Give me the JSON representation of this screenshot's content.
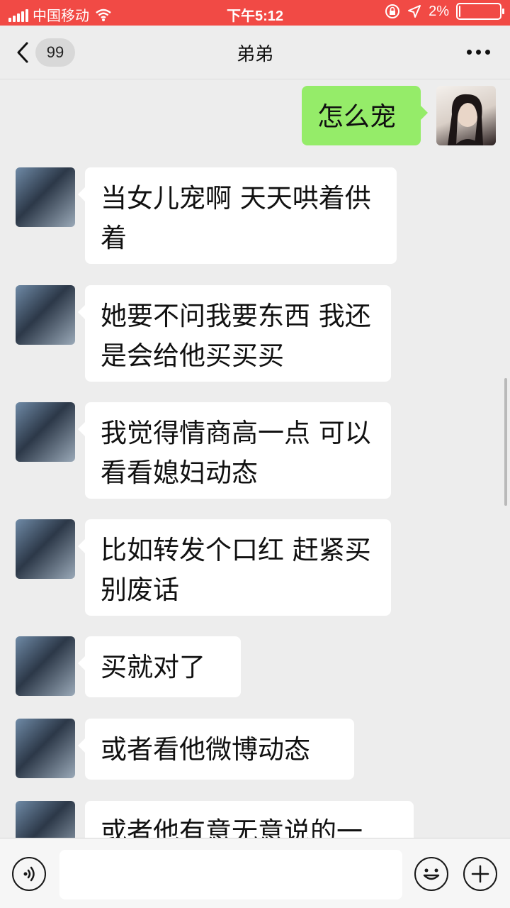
{
  "status_bar": {
    "carrier": "中国移动",
    "time": "下午5:12",
    "battery_text": "2%",
    "battery_level": 0.02
  },
  "nav": {
    "back_badge": "99",
    "title": "弟弟"
  },
  "messages": [
    {
      "sender": "me",
      "text": "怎么宠"
    },
    {
      "sender": "other",
      "text": "当女儿宠啊 天天哄着供着"
    },
    {
      "sender": "other",
      "text": "她要不问我要东西 我还是会给他买买买"
    },
    {
      "sender": "other",
      "text": "我觉得情商高一点 可以看看媳妇动态"
    },
    {
      "sender": "other",
      "text": "比如转发个口红 赶紧买 别废话"
    },
    {
      "sender": "other",
      "text": "买就对了"
    },
    {
      "sender": "other",
      "text": "或者看他微博动态"
    },
    {
      "sender": "other",
      "text": "或者他有意无意说的一"
    }
  ],
  "input_bar": {
    "placeholder": "",
    "voice_icon": "voice-icon",
    "emoji_icon": "emoji-icon",
    "plus_icon": "plus-icon"
  },
  "colors": {
    "status_bar": "#f14a45",
    "outgoing_bubble": "#95ec69",
    "incoming_bubble": "#ffffff",
    "background": "#ededed"
  }
}
